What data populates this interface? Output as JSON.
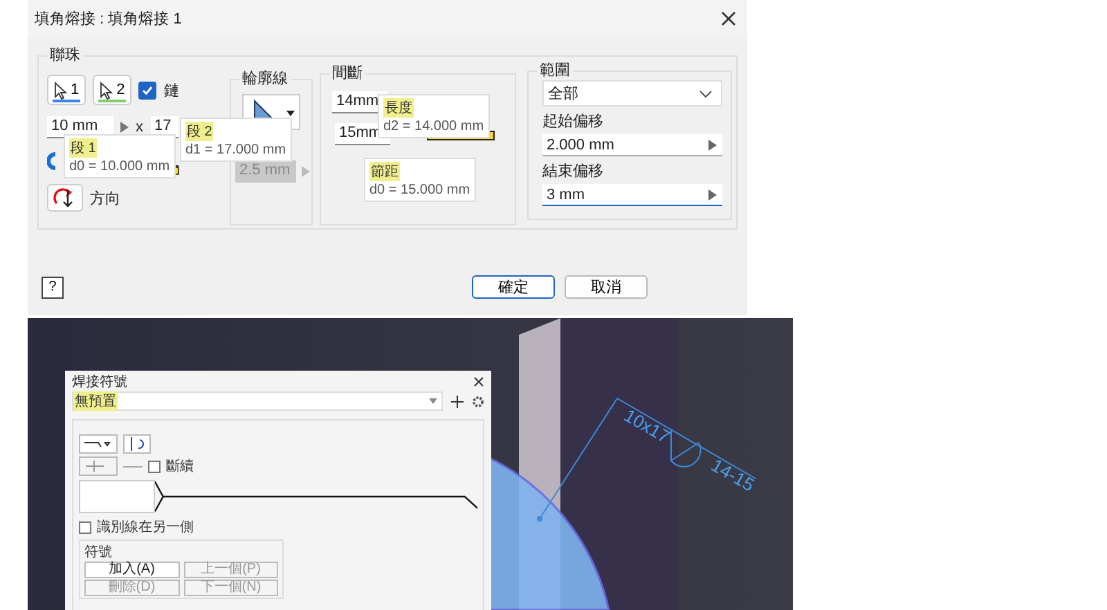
{
  "dialog": {
    "title": "填角熔接 : 填角熔接 1",
    "bead": {
      "label": "聯珠",
      "pick_buttons": [
        {
          "label": "1",
          "color": "#3b82f6"
        },
        {
          "label": "2",
          "color": "#7ccf6a"
        }
      ],
      "chain": {
        "label": "鏈",
        "checked": true
      },
      "size_1": "10 mm",
      "times": "x",
      "size_2": "17",
      "tooltips": [
        {
          "title": "段 1",
          "value": "d0 = 10.000 mm"
        },
        {
          "title": "段 2",
          "value": "d1 = 17.000 mm"
        }
      ],
      "direction": "方向"
    },
    "contour": {
      "label": "輪廓線",
      "offset": "2.5 mm",
      "disabled": true
    },
    "intermittent": {
      "label": "間斷",
      "length": "14mm",
      "pitch": "15mm",
      "tooltips": [
        {
          "title": "長度",
          "value": "d2 = 14.000 mm"
        },
        {
          "title": "節距",
          "value": "d0 = 15.000 mm"
        }
      ]
    },
    "extent": {
      "label": "範圍",
      "select": "全部",
      "start_label": "起始偏移",
      "start": "2.000 mm",
      "end_label": "結束偏移",
      "end": "3 mm"
    },
    "help": "?",
    "buttons": [
      {
        "label": "確定",
        "kind": "primary"
      },
      {
        "label": "取消",
        "kind": "secondary"
      }
    ]
  },
  "viewport": {
    "annotations": [
      "10x17",
      "14-15"
    ],
    "symbol_dialog": {
      "title": "焊接符號",
      "preset": "無預置",
      "stagger": {
        "label": "斷續",
        "checked": false
      },
      "flip": {
        "label": "識別線在另一側",
        "checked": false
      },
      "group_label": "符號",
      "buttons": [
        {
          "label": "加入(A)",
          "disabled": false
        },
        {
          "label": "上一個(P)",
          "disabled": true
        },
        {
          "label": "刪除(D)",
          "disabled": true
        },
        {
          "label": "下一個(N)",
          "disabled": true
        }
      ]
    }
  }
}
